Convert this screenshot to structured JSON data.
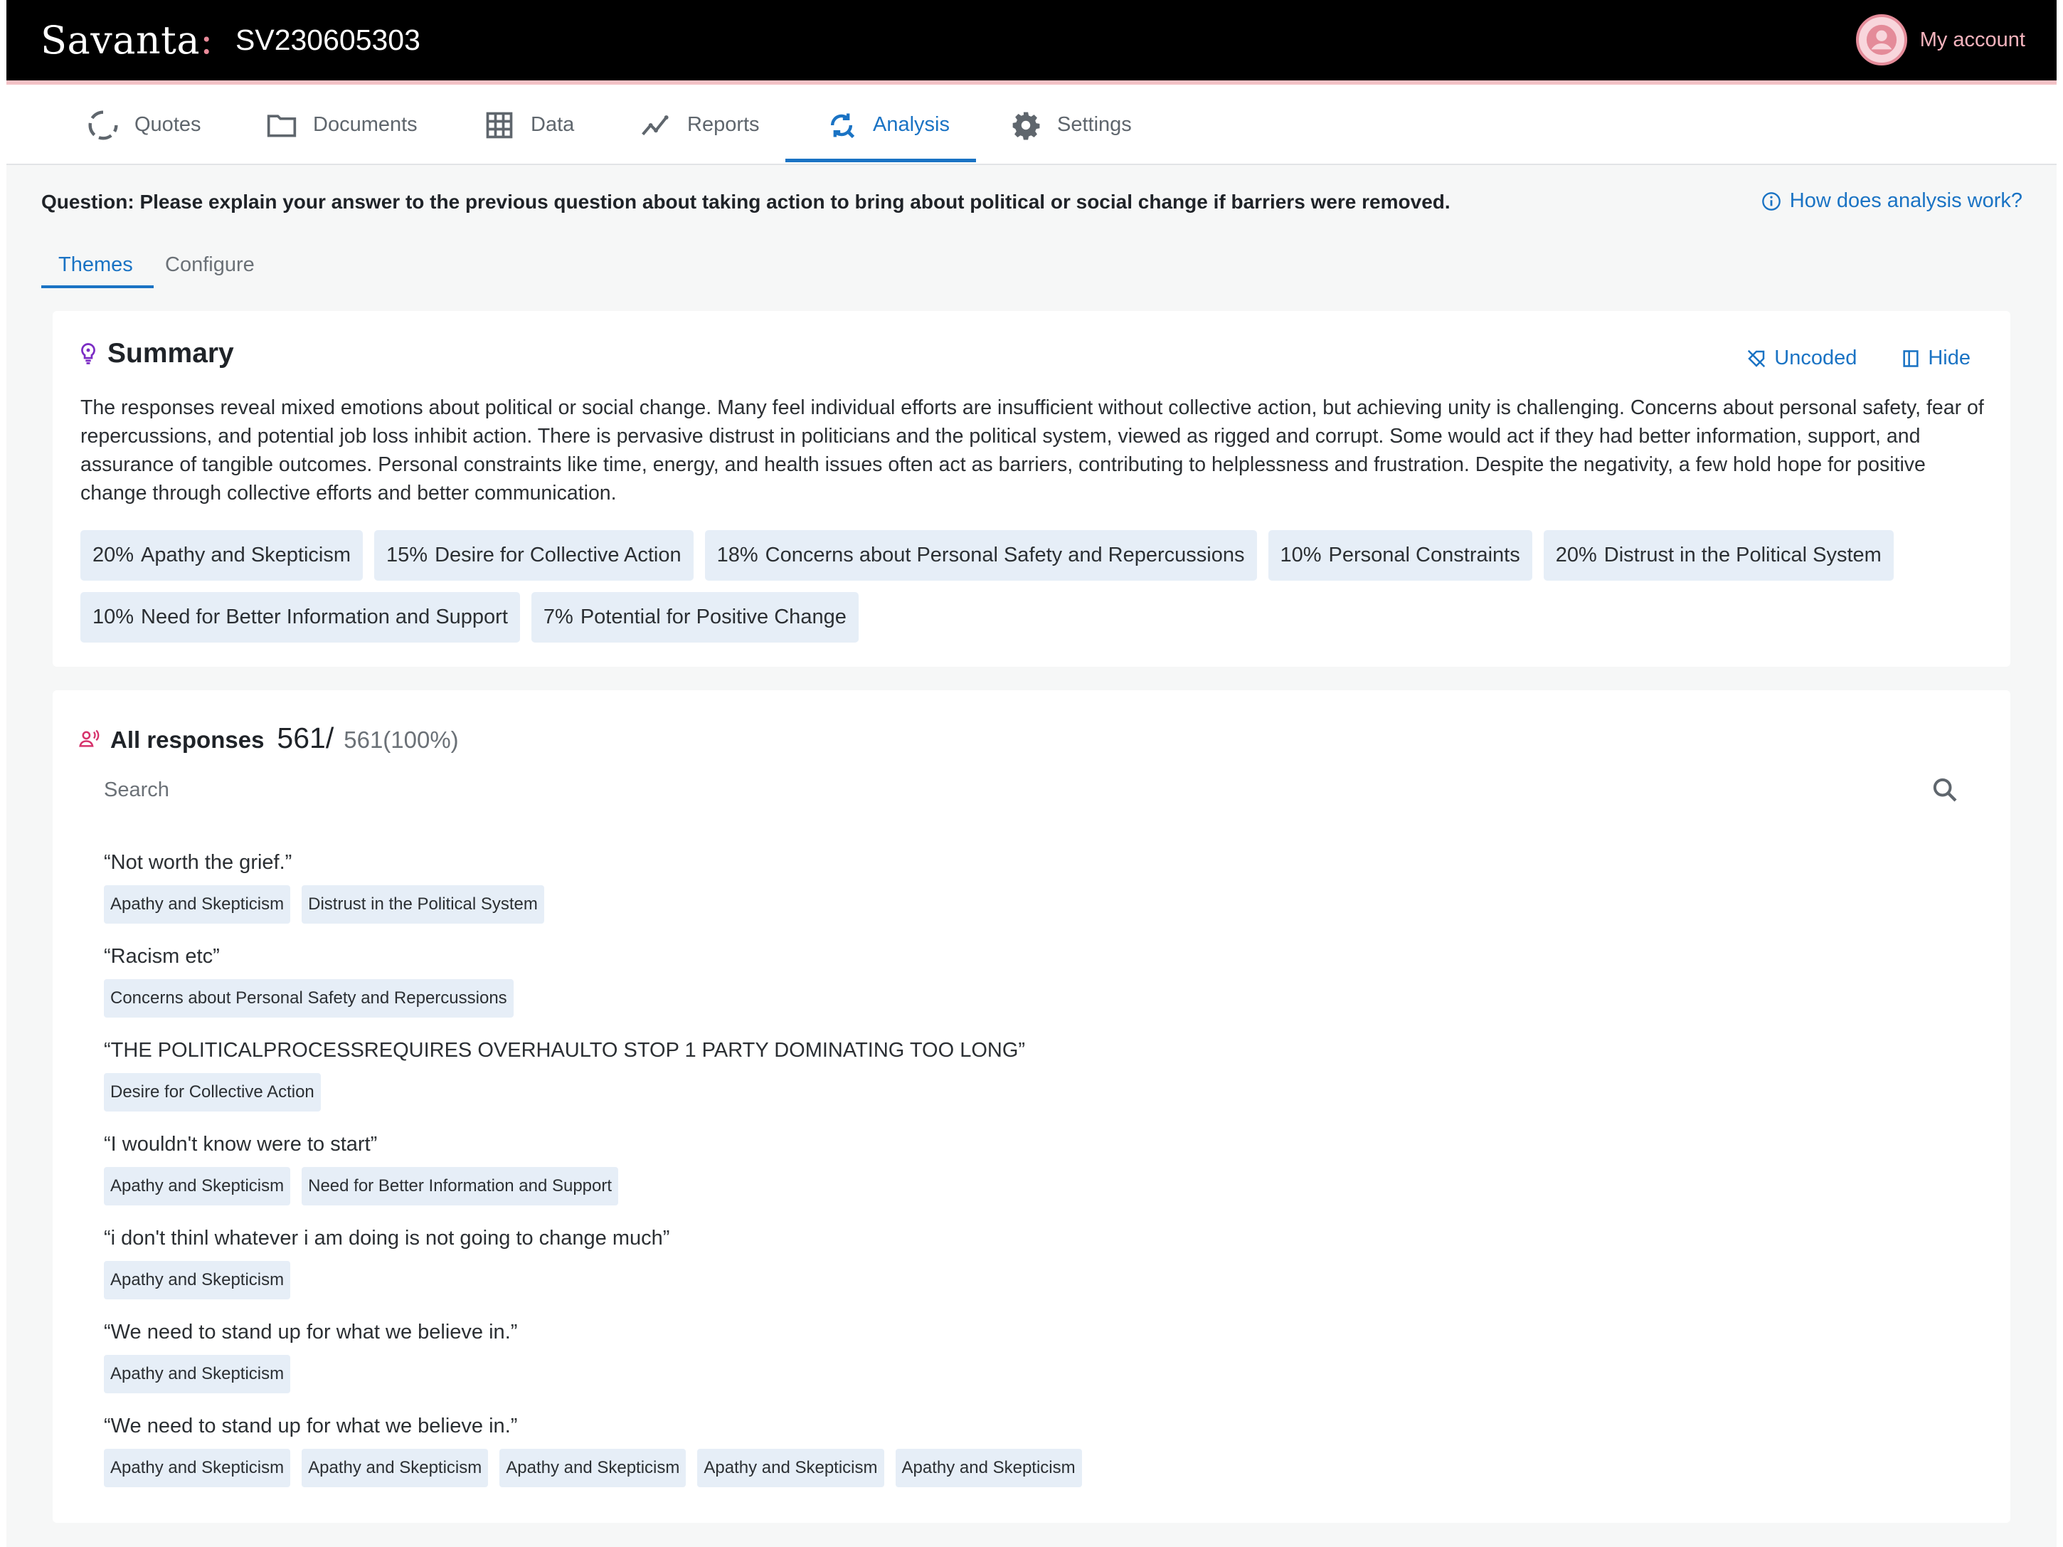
{
  "app": {
    "brand": "Savanta",
    "brand_colon": ":",
    "project_id": "SV230605303",
    "account_label": "My account"
  },
  "nav": [
    {
      "label": "Quotes",
      "icon": "quotes-icon"
    },
    {
      "label": "Documents",
      "icon": "folder-icon"
    },
    {
      "label": "Data",
      "icon": "grid-icon"
    },
    {
      "label": "Reports",
      "icon": "reports-icon"
    },
    {
      "label": "Analysis",
      "icon": "analysis-icon",
      "active": true
    },
    {
      "label": "Settings",
      "icon": "gear-icon"
    }
  ],
  "question": "Question: Please explain your answer to the previous question about taking action to bring about political or social change if barriers were removed.",
  "help_link": "How does analysis work?",
  "subtabs": [
    {
      "label": "Themes",
      "active": true
    },
    {
      "label": "Configure"
    }
  ],
  "summary": {
    "title": "Summary",
    "actions": {
      "uncoded": "Uncoded",
      "hide": "Hide"
    },
    "text": "The responses reveal mixed emotions about political or social change. Many feel individual efforts are insufficient without collective action, but achieving unity is challenging. Concerns about personal safety, fear of repercussions, and potential job loss inhibit action. There is pervasive distrust in politicians and the political system, viewed as rigged and corrupt. Some would act if they had better information, support, and assurance of tangible outcomes. Personal constraints like time, energy, and health issues often act as barriers, contributing to helplessness and frustration. Despite the negativity, a few hold hope for positive change through collective efforts and better communication.",
    "themes": [
      {
        "pct": "20%",
        "label": "Apathy and Skepticism"
      },
      {
        "pct": "15%",
        "label": "Desire for Collective Action"
      },
      {
        "pct": "18%",
        "label": "Concerns about Personal Safety and Repercussions"
      },
      {
        "pct": "10%",
        "label": "Personal Constraints"
      },
      {
        "pct": "20%",
        "label": "Distrust in the Political System"
      },
      {
        "pct": "10%",
        "label": "Need for Better Information and Support"
      },
      {
        "pct": "7%",
        "label": "Potential for Positive Change"
      }
    ]
  },
  "responses": {
    "title": "All responses",
    "count": "561/",
    "total": "561(100%)",
    "search_placeholder": "Search",
    "items": [
      {
        "quote": "“Not worth the grief.”",
        "tags": [
          "Apathy and Skepticism",
          "Distrust in the Political System"
        ]
      },
      {
        "quote": "“Racism etc”",
        "tags": [
          "Concerns about Personal Safety and Repercussions"
        ]
      },
      {
        "quote": "“THE POLITICALPROCESSREQUIRES OVERHAULTO STOP 1 PARTY DOMINATING TOO LONG”",
        "tags": [
          "Desire for Collective Action"
        ]
      },
      {
        "quote": "“I wouldn't know were to start”",
        "tags": [
          "Apathy and Skepticism",
          "Need for Better Information and Support"
        ]
      },
      {
        "quote": "“i don't thinl whatever i am doing is not going to change much”",
        "tags": [
          "Apathy and Skepticism"
        ]
      },
      {
        "quote": "“We need to stand up for what we believe in.”",
        "tags": [
          "Apathy and Skepticism"
        ]
      },
      {
        "quote": "“We need to stand up for what we believe in.”",
        "tags": [
          "Apathy and Skepticism",
          "Apathy and Skepticism",
          "Apathy and Skepticism",
          "Apathy and Skepticism",
          "Apathy and Skepticism"
        ]
      }
    ]
  },
  "colors": {
    "accent": "#1a73c4",
    "brand_pink": "#e98b9a",
    "chip_bg": "#e6eef7"
  }
}
